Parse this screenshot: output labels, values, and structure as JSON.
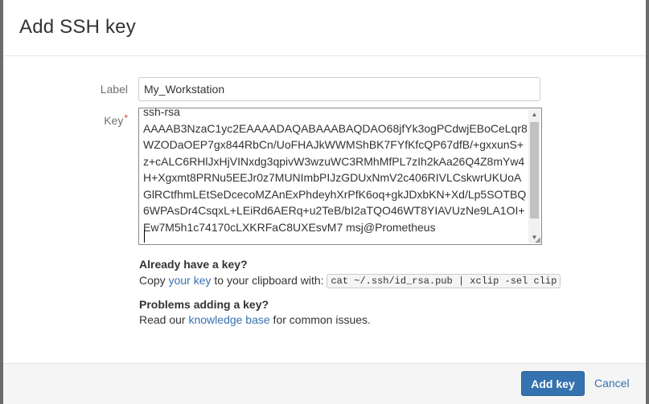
{
  "dialog": {
    "title": "Add SSH key"
  },
  "form": {
    "label_field_label": "Label",
    "label_value": "My_Workstation",
    "key_field_label": "Key",
    "required_marker": "*",
    "key_value": "ssh-rsa\nAAAAB3NzaC1yc2EAAAADAQABAAABAQDAO68jfYk3ogPCdwjEBoCeLqr8WZODaOEP7gx844RbCn/UoFHAJkWWMShBK7FYfKfcQP67dfB/+gxxunS+z+cALC6RHlJxHjVINxdg3qpivW3wzuWC3RMhMfPL7zIh2kAa26Q4Z8mYw4H+Xgxmt8PRNu5EEJr0z7MUNImbPIJzGDUxNmV2c406RIVLCskwrUKUoAGlRCtfhmLEtSeDcecoMZAnExPhdeyhXrPfK6oq+gkJDxbKN+Xd/Lp5SOTBQ6WPAsDr4CsqxL+LEiRd6AERq+u2TeB/bI2aTQO46WT8YIAVUzNe9LA1OI+Ew7M5h1c74170cLXKRFaC8UXEsvM7 msj@Prometheus"
  },
  "help": {
    "have_key_title": "Already have a key?",
    "copy_prefix": "Copy ",
    "copy_link": "your key",
    "copy_suffix": " to your clipboard with: ",
    "copy_command": "cat ~/.ssh/id_rsa.pub | xclip -sel clip",
    "problems_title": "Problems adding a key?",
    "read_prefix": "Read our ",
    "read_link": "knowledge base",
    "read_suffix": " for common issues."
  },
  "footer": {
    "add_button": "Add key",
    "cancel_link": "Cancel"
  },
  "icons": {
    "scroll_up": "scroll-up-arrow",
    "scroll_down": "scroll-down-arrow",
    "resize": "resize-grip"
  },
  "colors": {
    "primary": "#3572b0",
    "required": "#d04437"
  }
}
